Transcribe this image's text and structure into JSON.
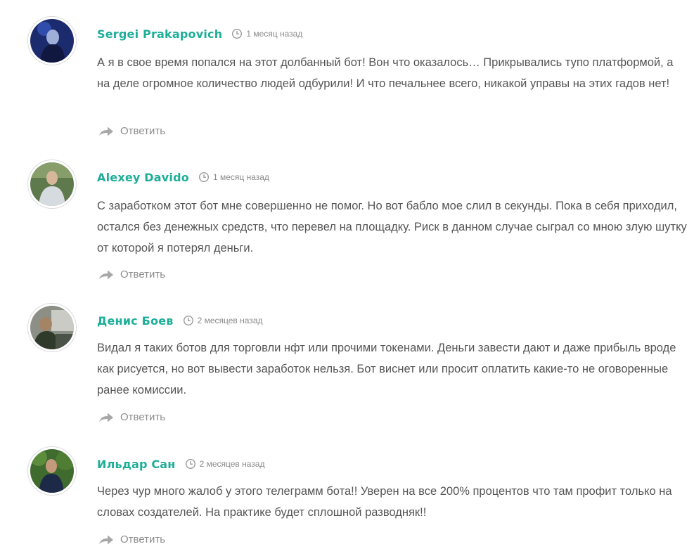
{
  "accent_color": "#1eae98",
  "reply_icon": "reply-arrow-icon",
  "clock_icon": "clock-icon",
  "comments": [
    {
      "author": "Sergei Prakapovich",
      "time": "1 месяц назад",
      "text": "А я в свое время попался на этот долбанный бот! Вон что оказалось… Прикрывались тупо платформой, а на деле огромное количество людей одбурили! И что печальнее всего, никакой управы на этих гадов нет!",
      "reply_label": "Ответить"
    },
    {
      "author": "Alexey Davido",
      "time": "1 месяц назад",
      "text": "С заработком этот бот мне совершенно не помог. Но вот бабло мое слил в секунды. Пока в себя приходил, остался без денежных средств, что перевел на площадку. Риск в данном случае сыграл со мною злую шутку от которой я потерял деньги.",
      "reply_label": "Ответить"
    },
    {
      "author": "Денис Боев",
      "time": "2 месяцев назад",
      "text": "Видал я таких ботов для торговли нфт или прочими токенами. Деньги завести дают и даже прибыль вроде как рисуется, но вот вывести заработок нельзя. Бот виснет или просит оплатить какие-то не оговоренные ранее комиссии.",
      "reply_label": "Ответить"
    },
    {
      "author": "Ильдар Сан",
      "time": "2 месяцев назад",
      "text": "Через чур много жалоб у этого телеграмм бота!! Уверен на все 200% процентов что там профит только на словах создателей. На практике будет сплошной разводняк!!",
      "reply_label": "Ответить"
    }
  ]
}
